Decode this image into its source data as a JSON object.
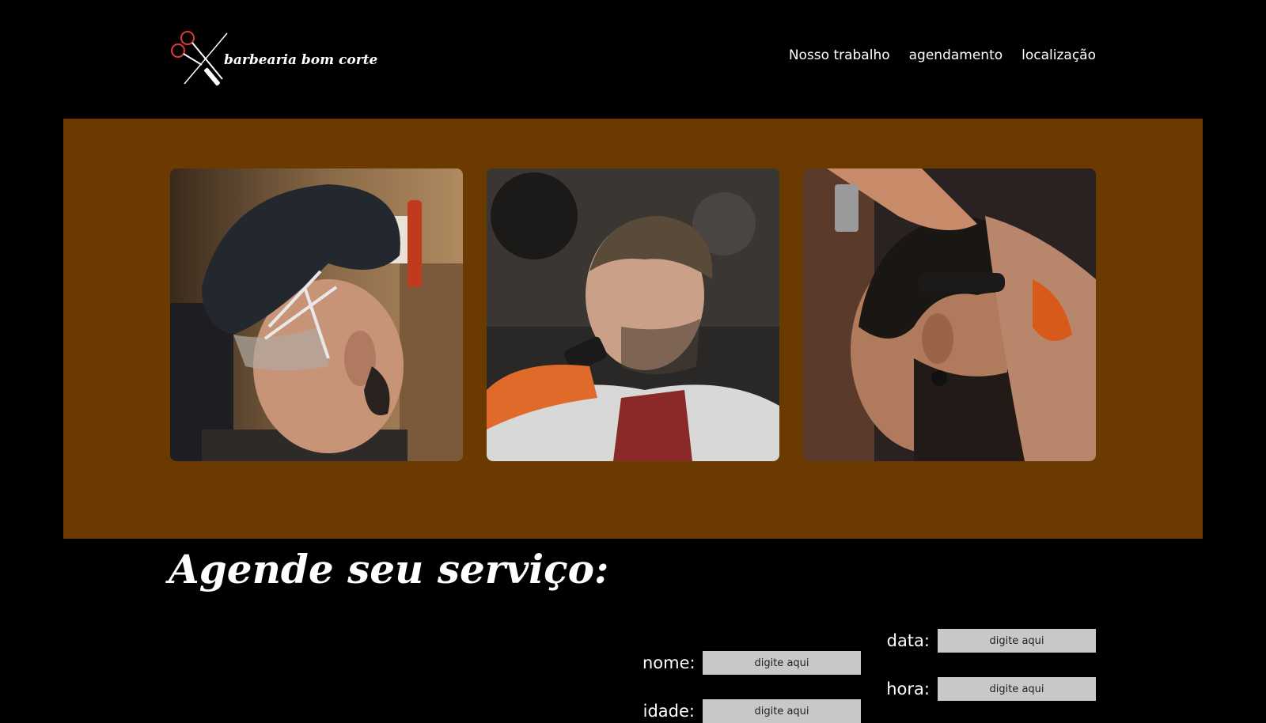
{
  "header": {
    "brand": "barbearia bom corte",
    "logo_icon": "scissors-razor-icon",
    "nav": [
      {
        "label": "Nosso trabalho"
      },
      {
        "label": "agendamento"
      },
      {
        "label": "localização"
      }
    ]
  },
  "gallery": {
    "background": "#6a3a00",
    "photos": [
      {
        "subject": "haircut-fade-with-lines-photo"
      },
      {
        "subject": "barber-clipper-fade-photo"
      },
      {
        "subject": "barber-razor-line-up-photo"
      }
    ]
  },
  "booking": {
    "title": "Agende seu serviço:",
    "fields": {
      "nome": {
        "label": "nome:",
        "placeholder": "digite aqui"
      },
      "idade": {
        "label": "idade:",
        "placeholder": "digite aqui"
      },
      "data": {
        "label": "data:",
        "placeholder": "digite aqui"
      },
      "hora": {
        "label": "hora:",
        "placeholder": "digite aqui"
      }
    }
  },
  "colors": {
    "page_bg": "#000000",
    "gallery_bg": "#6a3a00",
    "input_bg": "#c8c8c8",
    "text": "#ffffff",
    "logo_accent": "#e03a3a"
  }
}
